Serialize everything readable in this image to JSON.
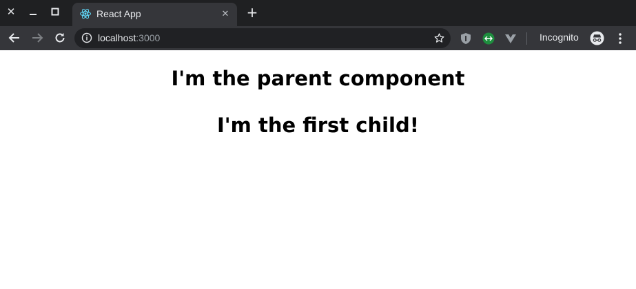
{
  "window": {
    "close_glyph": "✕",
    "minimize_glyph": "—",
    "maximize_glyph": "□"
  },
  "tab": {
    "title": "React App",
    "favicon": "react-icon",
    "close_glyph": "✕"
  },
  "new_tab_glyph": "+",
  "address_bar": {
    "host": "localhost",
    "port": ":3000"
  },
  "incognito_label": "Incognito",
  "page": {
    "parent_heading": "I'm the parent component",
    "child_heading": "I'm the first child!"
  },
  "colors": {
    "titlebar": "#1f2022",
    "toolbar": "#35363a",
    "omnibox": "#202124",
    "react_accent": "#61dafb",
    "extension_green": "#1e8e3e"
  }
}
